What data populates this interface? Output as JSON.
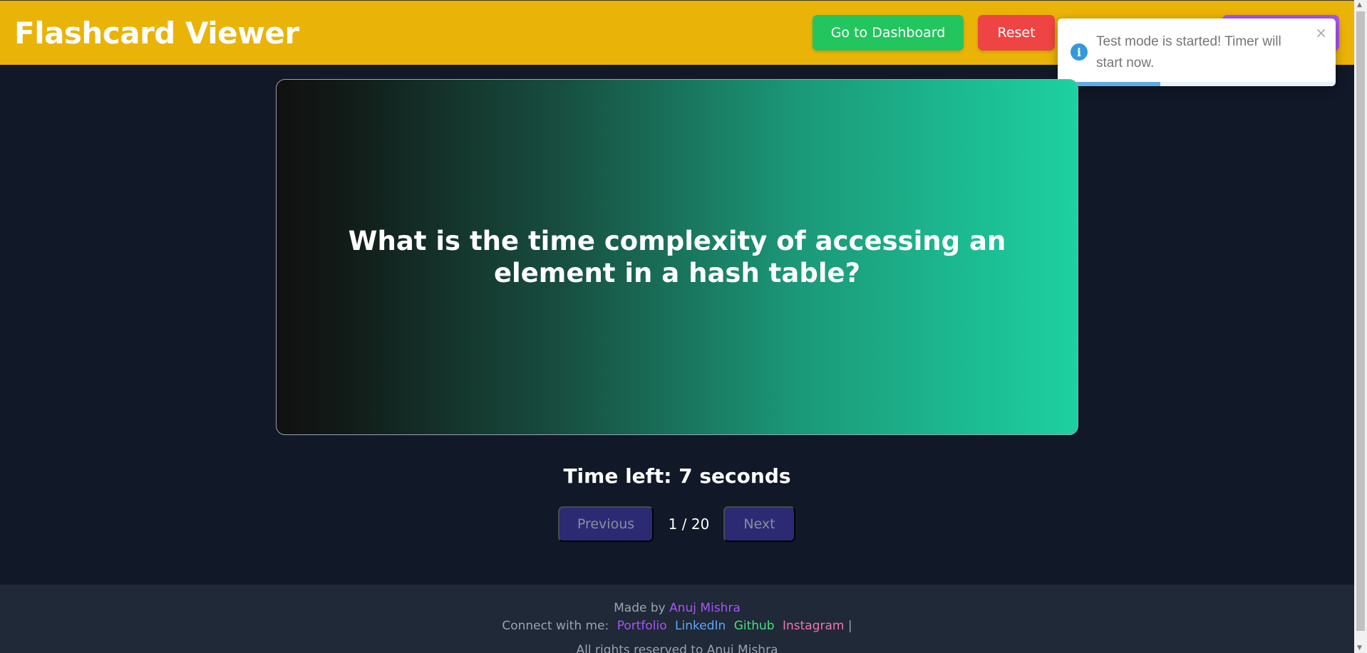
{
  "header": {
    "title": "Flashcard Viewer",
    "dashboard_label": "Go to Dashboard",
    "reset_label": "Reset",
    "brand_color": "#eab308"
  },
  "toast": {
    "message": "Test mode is started! Timer will start now.",
    "close_glyph": "×",
    "icon": "info-icon",
    "progress": 0.37
  },
  "card": {
    "question": "What is the time complexity of accessing an element in a hash table?"
  },
  "timer": {
    "text": "Time left: 7 seconds"
  },
  "navigation": {
    "previous_label": "Previous",
    "next_label": "Next",
    "page_indicator": "1 / 20"
  },
  "footer": {
    "made_by_prefix": "Made by",
    "author": "Anuj Mishra",
    "connect_prefix": "Connect with me:",
    "links": [
      "Portfolio",
      "LinkedIn",
      "Github",
      "Instagram"
    ],
    "separator": "|",
    "rights_partial": "All rights reserved to Anuj Mishra"
  }
}
